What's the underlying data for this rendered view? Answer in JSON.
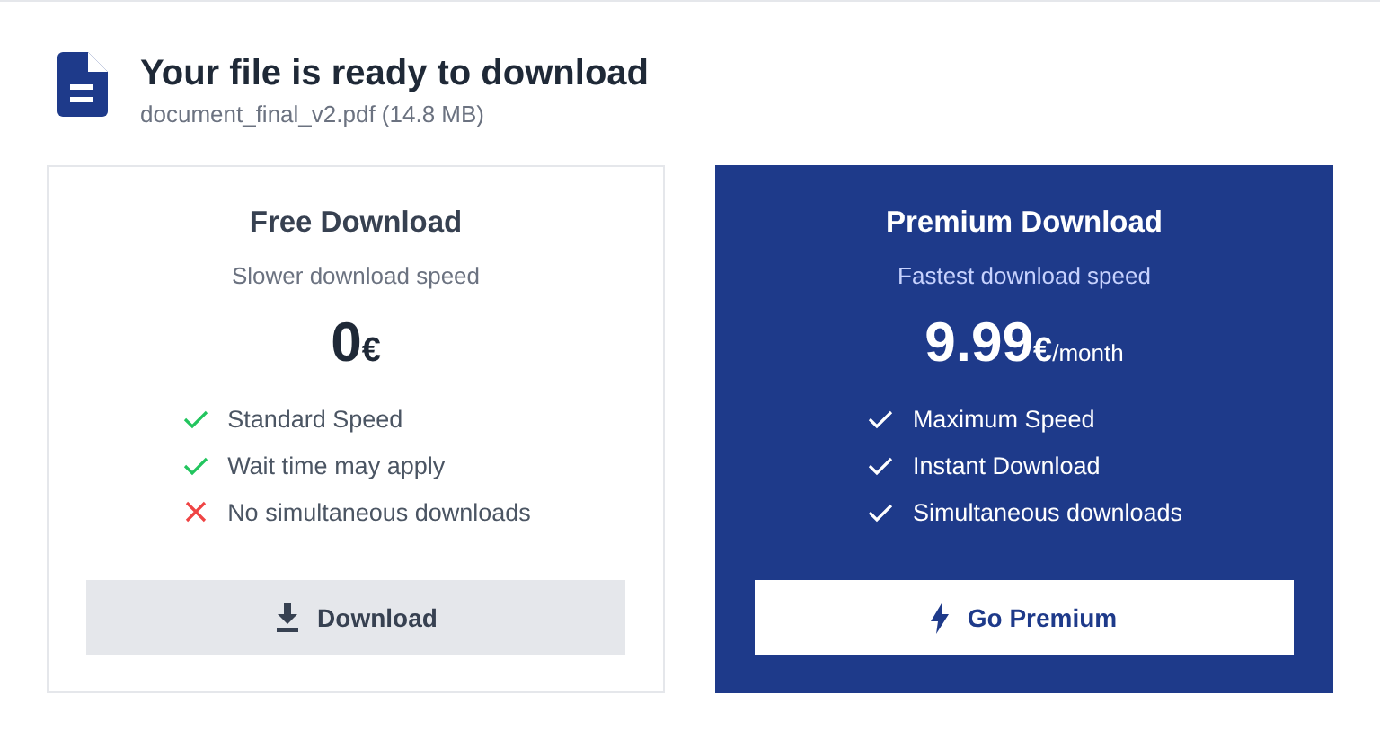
{
  "header": {
    "title": "Your file is ready to download",
    "file": "document_final_v2.pdf (14.8 MB)"
  },
  "plans": [
    {
      "title": "Free Download",
      "subtitle": "Slower download speed",
      "featured": false,
      "price": {
        "amount": "0",
        "currency": "€"
      },
      "features": [
        {
          "kind": "included",
          "label": "Standard Speed"
        },
        {
          "kind": "included",
          "label": "Wait time may apply"
        },
        {
          "kind": "excluded",
          "label": "No simultaneous downloads"
        }
      ],
      "button": {
        "kind": "download",
        "label": "Download"
      }
    },
    {
      "title": "Premium Download",
      "subtitle": "Fastest download speed",
      "featured": true,
      "price": {
        "amount": "9.99",
        "currency": "€",
        "period": "/month"
      },
      "features": [
        {
          "kind": "included",
          "label": "Maximum Speed"
        },
        {
          "kind": "included",
          "label": "Instant Download"
        },
        {
          "kind": "included",
          "label": "Simultaneous downloads"
        }
      ],
      "button": {
        "kind": "premium",
        "label": "Go Premium"
      }
    }
  ]
}
